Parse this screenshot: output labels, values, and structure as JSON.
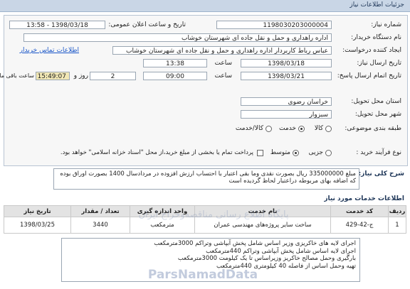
{
  "header": {
    "title": "جزئیات اطلاعات نیاز"
  },
  "form": {
    "need_number_label": "شماره نیاز:",
    "need_number": "1198030203000004",
    "announce_label": "تاریخ و ساعت اعلان عمومی:",
    "announce_value": "1398/03/18 - 13:58",
    "buyer_org_label": "نام دستگاه خریدار:",
    "buyer_org": "اداره راهداری و حمل و نقل جاده ای شهرستان خوشاب",
    "creator_label": "ایجاد کننده درخواست:",
    "creator": "عباس رباط کاربردار اداره راهداری و حمل و نقل جاده ای شهرستان خوشاب",
    "contact_link": "اطلاعات تماس خریدار",
    "send_date_label": "تاریخ ارسال نیاز:",
    "send_date": "1398/03/18",
    "time_label": "ساعت",
    "send_time": "13:38",
    "deadline_label": "تاریخ اتمام ارسال پاسخ:",
    "deadline_date": "1398/03/21",
    "deadline_time": "09:00",
    "days": "2",
    "days_label": "روز و",
    "remaining": "15:49:07",
    "remaining_label": "ساعت باقی مانده",
    "province_label": "استان محل تحویل:",
    "province": "خراسان رضوی",
    "city_label": "شهر محل تحویل:",
    "city": "سبزوار",
    "category_label": "طبقه بندی موضوعی:",
    "category_options": [
      "کالا",
      "خدمت",
      "کالا/خدمت"
    ],
    "process_label": "نوع فرآیند خرید :",
    "process_options": [
      "جزیی",
      "متوسط"
    ],
    "payment_note": "پرداخت تمام یا بخشی از مبلغ خرید،از محل \"اسناد خزانه اسلامی\" خواهد بود."
  },
  "general_desc": {
    "label": "شرح کلی نیاز:",
    "text": "مبلغ 335000000 ریال بصورت نقدی وما بقی اعتبار با احتساب ارزش افزوده در مردادسال 1400 بصورت اوراق بوده که اضافه بهای مربوطه دراعتبار لحاظ گردیده است"
  },
  "services": {
    "title": "اطلاعات خدمات مورد نیاز",
    "columns": [
      "ردیف",
      "کد خدمت",
      "نام خدمت",
      "واحد اندازه گیری",
      "تعداد / مقدار",
      "تاریخ نیاز"
    ],
    "rows": [
      {
        "row": "1",
        "code": "ج-42-429",
        "name": "ساخت سایر پروژه‌های مهندسی عمران",
        "unit": "مترمکعب",
        "qty": "3440",
        "date": "1398/03/25"
      }
    ]
  },
  "buyer_notes": {
    "lines": [
      "اجرای لایه های خاکریزی وزیر اساس شامل پخش آبپاشی وتراکم 3000مترمکعب",
      "اجرای لایه اساس شامل پخش آبپاشی وتراکم 440مترمکعب",
      "بارگیری وحمل مصالح خاکریز وزیراساس تا یک کیلومت 3000مترمکعب",
      "تهیه وحمل اساس از فاصله 40 کیلومتری 440مترمکعب"
    ]
  },
  "watermark": {
    "fa": "پایگاه اطلاع رسانی مناقصه‌وحراج ایران",
    "en": "ParsNamadData"
  }
}
